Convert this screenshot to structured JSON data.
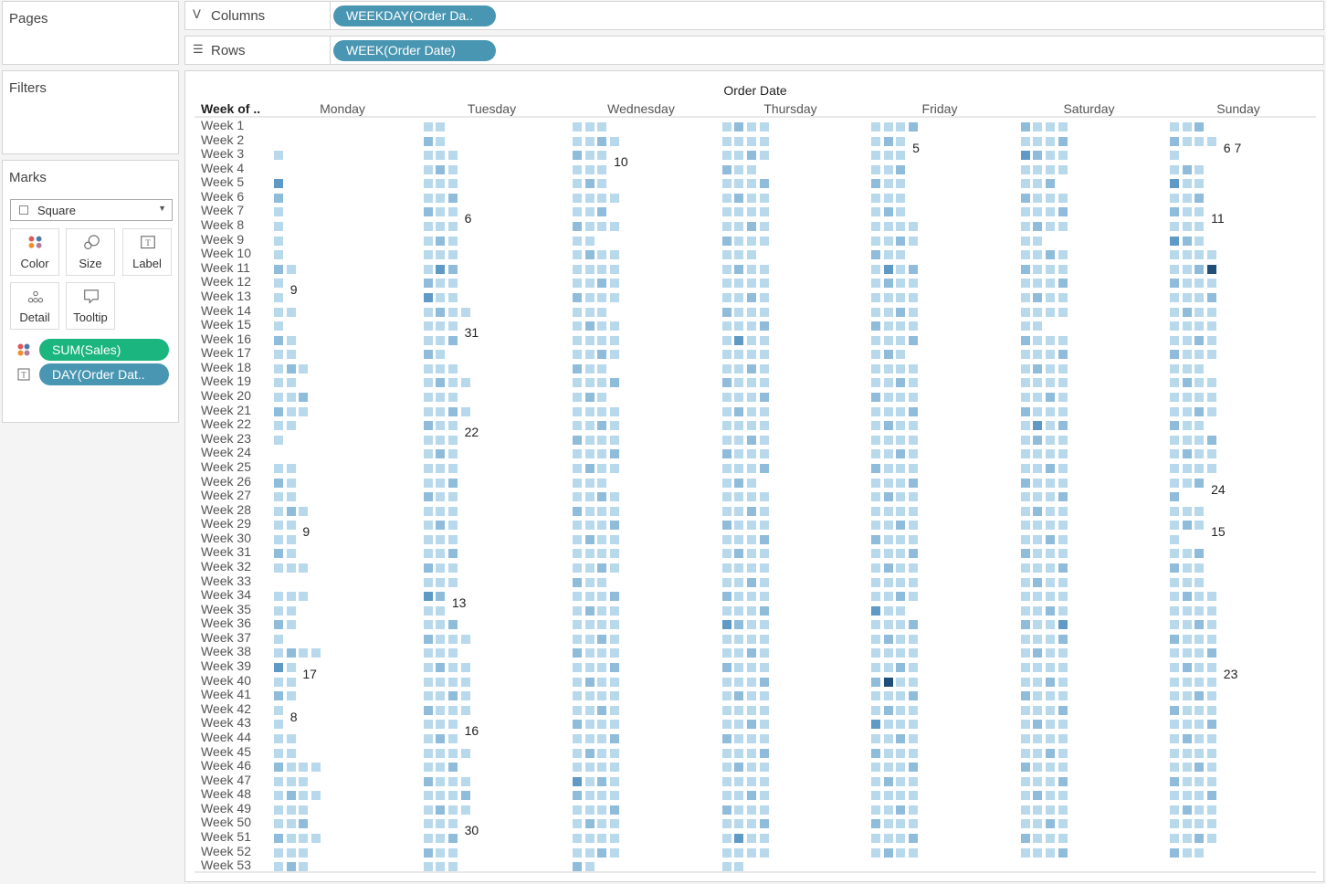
{
  "shelves": {
    "pages_title": "Pages",
    "filters_title": "Filters",
    "columns_label": "Columns",
    "columns_pill": "WEEKDAY(Order Da..",
    "rows_label": "Rows",
    "rows_pill": "WEEK(Order Date)"
  },
  "marks": {
    "title": "Marks",
    "mark_type": "Square",
    "buttons": [
      "Color",
      "Size",
      "Label",
      "Detail",
      "Tooltip"
    ],
    "pills": [
      {
        "label": "SUM(Sales)",
        "icon": "color-icon",
        "color": "#1bb57f"
      },
      {
        "label": "DAY(Order Dat..",
        "icon": "label-icon",
        "color": "#4996b2"
      }
    ]
  },
  "colors": {
    "light": "#b8d9ec",
    "mid": "#8fbcdb",
    "dark": "#5f9ac7",
    "max": "#1f4e79"
  },
  "chart_data": {
    "type": "heatmap",
    "title": "Order Date",
    "row_header": "Week of ..",
    "columns": [
      "Monday",
      "Tuesday",
      "Wednesday",
      "Thursday",
      "Friday",
      "Saturday",
      "Sunday"
    ],
    "rows": [
      "Week 1",
      "Week 2",
      "Week 3",
      "Week 4",
      "Week 5",
      "Week 6",
      "Week 7",
      "Week 8",
      "Week 9",
      "Week 10",
      "Week 11",
      "Week 12",
      "Week 13",
      "Week 14",
      "Week 15",
      "Week 16",
      "Week 17",
      "Week 18",
      "Week 19",
      "Week 20",
      "Week 21",
      "Week 22",
      "Week 23",
      "Week 24",
      "Week 25",
      "Week 26",
      "Week 27",
      "Week 28",
      "Week 29",
      "Week 30",
      "Week 31",
      "Week 32",
      "Week 33",
      "Week 34",
      "Week 35",
      "Week 36",
      "Week 37",
      "Week 38",
      "Week 39",
      "Week 40",
      "Week 41",
      "Week 42",
      "Week 43",
      "Week 44",
      "Week 45",
      "Week 46",
      "Week 47",
      "Week 48",
      "Week 49",
      "Week 50",
      "Week 51",
      "Week 52",
      "Week 53"
    ],
    "cells": [
      [
        0,
        2,
        3,
        4,
        4,
        4,
        3
      ],
      [
        0,
        2,
        4,
        4,
        3,
        4,
        4
      ],
      [
        1,
        3,
        3,
        4,
        3,
        4,
        1
      ],
      [
        0,
        3,
        3,
        3,
        3,
        4,
        3
      ],
      [
        1,
        3,
        3,
        4,
        3,
        3,
        3
      ],
      [
        1,
        3,
        4,
        4,
        3,
        4,
        3
      ],
      [
        1,
        3,
        3,
        4,
        3,
        4,
        3
      ],
      [
        1,
        3,
        4,
        4,
        4,
        4,
        3
      ],
      [
        1,
        3,
        2,
        4,
        4,
        2,
        3
      ],
      [
        1,
        3,
        4,
        3,
        3,
        4,
        4
      ],
      [
        2,
        3,
        4,
        4,
        4,
        4,
        4
      ],
      [
        1,
        3,
        4,
        4,
        4,
        4,
        4
      ],
      [
        1,
        3,
        4,
        4,
        4,
        4,
        4
      ],
      [
        2,
        4,
        3,
        4,
        4,
        4,
        4
      ],
      [
        1,
        3,
        4,
        4,
        4,
        2,
        4
      ],
      [
        2,
        3,
        4,
        4,
        4,
        4,
        4
      ],
      [
        2,
        2,
        4,
        4,
        3,
        4,
        4
      ],
      [
        3,
        3,
        3,
        4,
        4,
        4,
        3
      ],
      [
        2,
        4,
        4,
        4,
        4,
        4,
        4
      ],
      [
        3,
        3,
        3,
        4,
        4,
        4,
        4
      ],
      [
        3,
        4,
        4,
        4,
        4,
        4,
        4
      ],
      [
        2,
        3,
        4,
        4,
        4,
        4,
        3
      ],
      [
        1,
        3,
        4,
        4,
        4,
        4,
        4
      ],
      [
        0,
        3,
        4,
        4,
        4,
        4,
        4
      ],
      [
        2,
        3,
        4,
        4,
        4,
        4,
        4
      ],
      [
        2,
        3,
        3,
        3,
        4,
        4,
        3
      ],
      [
        2,
        3,
        4,
        4,
        4,
        4,
        1
      ],
      [
        3,
        3,
        4,
        4,
        4,
        4,
        3
      ],
      [
        2,
        3,
        4,
        4,
        4,
        4,
        3
      ],
      [
        2,
        3,
        4,
        4,
        4,
        4,
        1
      ],
      [
        2,
        3,
        4,
        4,
        4,
        4,
        3
      ],
      [
        3,
        3,
        4,
        4,
        4,
        4,
        3
      ],
      [
        0,
        3,
        3,
        4,
        4,
        4,
        3
      ],
      [
        3,
        2,
        4,
        4,
        4,
        4,
        4
      ],
      [
        2,
        2,
        4,
        4,
        3,
        4,
        4
      ],
      [
        2,
        3,
        4,
        4,
        4,
        4,
        4
      ],
      [
        1,
        4,
        4,
        4,
        4,
        4,
        4
      ],
      [
        4,
        3,
        4,
        4,
        4,
        4,
        4
      ],
      [
        2,
        4,
        4,
        4,
        4,
        4,
        4
      ],
      [
        2,
        4,
        4,
        4,
        4,
        4,
        4
      ],
      [
        2,
        4,
        4,
        4,
        4,
        4,
        4
      ],
      [
        1,
        4,
        4,
        4,
        4,
        4,
        4
      ],
      [
        1,
        3,
        4,
        4,
        4,
        4,
        4
      ],
      [
        2,
        3,
        4,
        4,
        4,
        4,
        4
      ],
      [
        2,
        4,
        4,
        4,
        4,
        4,
        4
      ],
      [
        4,
        3,
        4,
        4,
        4,
        4,
        4
      ],
      [
        3,
        4,
        4,
        4,
        4,
        4,
        4
      ],
      [
        4,
        4,
        4,
        4,
        4,
        4,
        4
      ],
      [
        3,
        4,
        4,
        4,
        4,
        4,
        4
      ],
      [
        3,
        3,
        4,
        4,
        4,
        4,
        4
      ],
      [
        4,
        3,
        4,
        4,
        4,
        4,
        4
      ],
      [
        3,
        3,
        4,
        4,
        4,
        4,
        3
      ],
      [
        3,
        3,
        2,
        2,
        0,
        0,
        0
      ]
    ],
    "cells_note_units": "number of order-days shown per cell (squares)",
    "labels": [
      {
        "row": 1,
        "col": 4,
        "text": "5"
      },
      {
        "row": 1,
        "col": 6,
        "text": "6 7"
      },
      {
        "row": 2,
        "col": 2,
        "text": "10"
      },
      {
        "row": 6,
        "col": 1,
        "text": "6"
      },
      {
        "row": 6,
        "col": 6,
        "text": "11"
      },
      {
        "row": 11,
        "col": 0,
        "text": "9"
      },
      {
        "row": 14,
        "col": 1,
        "text": "31"
      },
      {
        "row": 21,
        "col": 1,
        "text": "22"
      },
      {
        "row": 25,
        "col": 6,
        "text": "24"
      },
      {
        "row": 28,
        "col": 0,
        "text": "9"
      },
      {
        "row": 28,
        "col": 6,
        "text": "15"
      },
      {
        "row": 33,
        "col": 1,
        "text": "13"
      },
      {
        "row": 38,
        "col": 0,
        "text": "17"
      },
      {
        "row": 38,
        "col": 6,
        "text": "23"
      },
      {
        "row": 41,
        "col": 0,
        "text": "8"
      },
      {
        "row": 42,
        "col": 1,
        "text": "16"
      },
      {
        "row": 49,
        "col": 1,
        "text": "30"
      }
    ],
    "highlight_dark": [
      {
        "row": 2,
        "col": 5,
        "idx": 0
      },
      {
        "row": 4,
        "col": 0,
        "idx": 0
      },
      {
        "row": 4,
        "col": 6,
        "idx": 0
      },
      {
        "row": 8,
        "col": 6,
        "idx": 0
      },
      {
        "row": 10,
        "col": 1,
        "idx": 1
      },
      {
        "row": 10,
        "col": 4,
        "idx": 1
      },
      {
        "row": 12,
        "col": 1,
        "idx": 0
      },
      {
        "row": 15,
        "col": 3,
        "idx": 1
      },
      {
        "row": 21,
        "col": 5,
        "idx": 1
      },
      {
        "row": 33,
        "col": 1,
        "idx": 0
      },
      {
        "row": 34,
        "col": 4,
        "idx": 0
      },
      {
        "row": 35,
        "col": 3,
        "idx": 0
      },
      {
        "row": 35,
        "col": 5,
        "idx": 3
      },
      {
        "row": 38,
        "col": 0,
        "idx": 0
      },
      {
        "row": 42,
        "col": 4,
        "idx": 0
      },
      {
        "row": 46,
        "col": 2,
        "idx": 0
      },
      {
        "row": 50,
        "col": 3,
        "idx": 1
      }
    ],
    "highlight_max": [
      {
        "row": 10,
        "col": 6,
        "idx": 3
      },
      {
        "row": 39,
        "col": 4,
        "idx": 1
      }
    ]
  }
}
